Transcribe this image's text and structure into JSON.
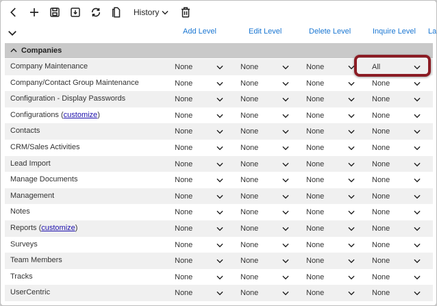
{
  "toolbar": {
    "icons": [
      "back-icon",
      "add-icon",
      "save-icon",
      "save-and-close-icon",
      "refresh-icon",
      "copy-icon"
    ],
    "history_label": "History",
    "delete_icon": "trash-icon"
  },
  "columns": {
    "add": "Add Level",
    "edit": "Edit Level",
    "delete": "Delete Level",
    "inquire": "Inquire Level",
    "next": "La"
  },
  "group": {
    "label": "Companies"
  },
  "rows": [
    {
      "label": "Company Maintenance",
      "link": "",
      "add": "None",
      "edit": "None",
      "delete": "None",
      "inquire": "All"
    },
    {
      "label": "Company/Contact Group Maintenance",
      "link": "",
      "add": "None",
      "edit": "None",
      "delete": "None",
      "inquire": "None"
    },
    {
      "label": "Configuration - Display Passwords",
      "link": "",
      "add": "None",
      "edit": "None",
      "delete": "None",
      "inquire": "None"
    },
    {
      "label": "Configurations (",
      "link": "customize",
      "suffix": ")",
      "add": "None",
      "edit": "None",
      "delete": "None",
      "inquire": "None"
    },
    {
      "label": "Contacts",
      "link": "",
      "add": "None",
      "edit": "None",
      "delete": "None",
      "inquire": "None"
    },
    {
      "label": "CRM/Sales Activities",
      "link": "",
      "add": "None",
      "edit": "None",
      "delete": "None",
      "inquire": "None"
    },
    {
      "label": "Lead Import",
      "link": "",
      "add": "None",
      "edit": "None",
      "delete": "None",
      "inquire": "None"
    },
    {
      "label": "Manage Documents",
      "link": "",
      "add": "None",
      "edit": "None",
      "delete": "None",
      "inquire": "None"
    },
    {
      "label": "Management",
      "link": "",
      "add": "None",
      "edit": "None",
      "delete": "None",
      "inquire": "None"
    },
    {
      "label": "Notes",
      "link": "",
      "add": "None",
      "edit": "None",
      "delete": "None",
      "inquire": "None"
    },
    {
      "label": "Reports (",
      "link": "customize",
      "suffix": ")",
      "add": "None",
      "edit": "None",
      "delete": "None",
      "inquire": "None"
    },
    {
      "label": "Surveys",
      "link": "",
      "add": "None",
      "edit": "None",
      "delete": "None",
      "inquire": "None"
    },
    {
      "label": "Team Members",
      "link": "",
      "add": "None",
      "edit": "None",
      "delete": "None",
      "inquire": "None"
    },
    {
      "label": "Tracks",
      "link": "",
      "add": "None",
      "edit": "None",
      "delete": "None",
      "inquire": "None"
    },
    {
      "label": "UserCentric",
      "link": "",
      "add": "None",
      "edit": "None",
      "delete": "None",
      "inquire": "None"
    }
  ],
  "colors": {
    "header_link": "#1976d2",
    "highlight": "#8b1c24",
    "group_bg": "#c9c9c9"
  }
}
